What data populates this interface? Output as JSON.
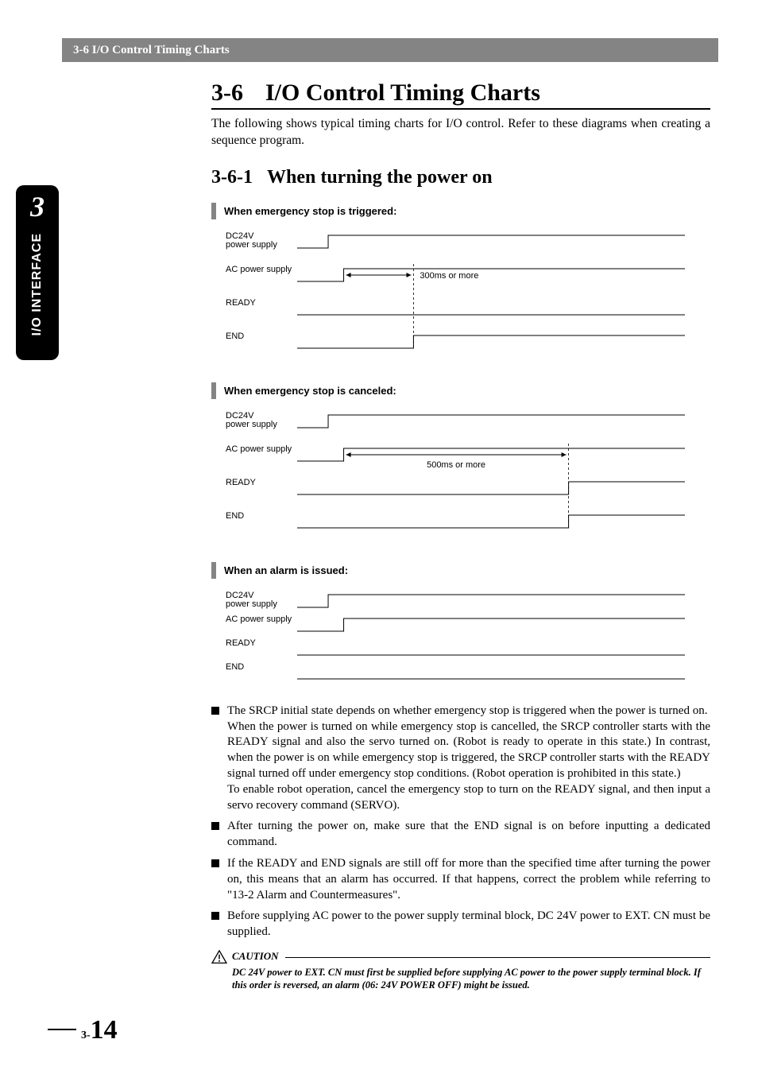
{
  "header": "3-6 I/O Control Timing Charts",
  "side_tab": {
    "num": "3",
    "label": "I/O INTERFACE"
  },
  "h1": {
    "num": "3-6",
    "title": "I/O Control Timing Charts"
  },
  "intro": "The following shows typical timing charts for I/O control. Refer to these diagrams when creating a sequence program.",
  "h2": {
    "num": "3-6-1",
    "title": "When turning the power on"
  },
  "chart_data": [
    {
      "title": "When emergency stop is triggered:",
      "signals": [
        {
          "name": "DC24V power supply",
          "transitions": [
            {
              "t": 0.08,
              "to": "high"
            }
          ]
        },
        {
          "name": "AC power supply",
          "transitions": [
            {
              "t": 0.12,
              "to": "high"
            }
          ]
        },
        {
          "name": "READY",
          "transitions": []
        },
        {
          "name": "END",
          "transitions": [
            {
              "t": 0.3,
              "to": "high"
            }
          ]
        }
      ],
      "annotation": {
        "text": "300ms or more",
        "from_signal": "AC power supply",
        "from_t": 0.12,
        "to_t": 0.3
      }
    },
    {
      "title": "When emergency stop is canceled:",
      "signals": [
        {
          "name": "DC24V power supply",
          "transitions": [
            {
              "t": 0.08,
              "to": "high"
            }
          ]
        },
        {
          "name": "AC power supply",
          "transitions": [
            {
              "t": 0.12,
              "to": "high"
            }
          ]
        },
        {
          "name": "READY",
          "transitions": [
            {
              "t": 0.7,
              "to": "high"
            }
          ]
        },
        {
          "name": "END",
          "transitions": [
            {
              "t": 0.7,
              "to": "high"
            }
          ]
        }
      ],
      "annotation": {
        "text": "500ms or more",
        "from_signal": "AC power supply",
        "from_t": 0.12,
        "to_t": 0.7
      }
    },
    {
      "title": "When an alarm is issued:",
      "signals": [
        {
          "name": "DC24V power supply",
          "transitions": [
            {
              "t": 0.08,
              "to": "high"
            }
          ]
        },
        {
          "name": "AC power supply",
          "transitions": [
            {
              "t": 0.12,
              "to": "high"
            }
          ]
        },
        {
          "name": "READY",
          "transitions": []
        },
        {
          "name": "END",
          "transitions": []
        }
      ],
      "annotation": null
    }
  ],
  "bullets": [
    {
      "lead": "The SRCP initial state depends on whether emergency stop is triggered when the power is turned on.",
      "subs": [
        "When the power is turned on while emergency stop is cancelled, the SRCP controller starts with the READY signal and also the servo turned on. (Robot is ready to operate in this state.) In contrast, when the power is on while emergency stop is triggered, the SRCP controller starts with the READY signal turned off under emergency stop conditions. (Robot operation is prohibited in this state.)",
        "To enable robot operation, cancel the emergency stop to turn on the READY signal, and then input a servo recovery command (SERVO)."
      ]
    },
    {
      "lead": "After turning the power on, make sure that the END signal is on before inputting a dedicated command.",
      "subs": []
    },
    {
      "lead": "If the READY and END signals are still off for more than the specified time after turning the power on, this means that an alarm has occurred. If that happens, correct the problem while referring to \"13-2 Alarm and Countermeasures\".",
      "subs": []
    },
    {
      "lead": "Before supplying AC power to the power supply terminal block, DC 24V power to EXT. CN must be supplied.",
      "subs": []
    }
  ],
  "caution": {
    "label": "CAUTION",
    "body": "DC 24V power to EXT. CN must first be supplied before supplying AC power to the power supply terminal block. If this order is reversed, an alarm (06: 24V POWER OFF) might be issued."
  },
  "page": {
    "prefix": "3-",
    "num": "14"
  }
}
